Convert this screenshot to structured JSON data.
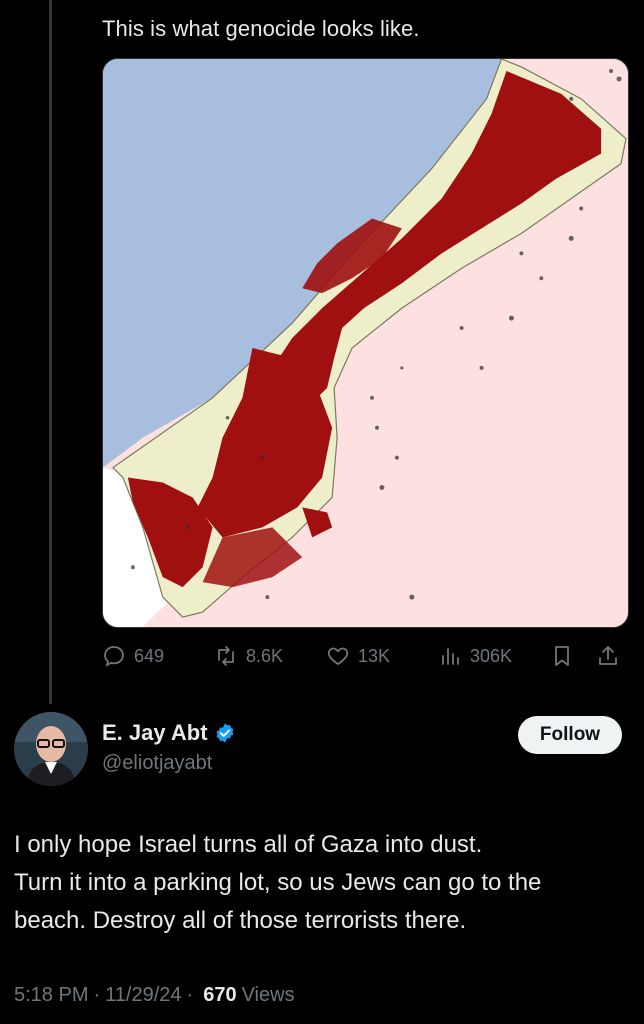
{
  "quoted_tweet": {
    "text": "This is what genocide looks like.",
    "stats": {
      "replies": "649",
      "reposts": "8.6K",
      "likes": "13K",
      "views": "306K"
    }
  },
  "tweet": {
    "author": {
      "name": "E. Jay Abt",
      "handle": "@eliotjayabt",
      "verified": true
    },
    "follow_label": "Follow",
    "body_lines": [
      "I only hope Israel turns all of Gaza into dust.",
      "Turn it into a parking lot, so us Jews can go to the",
      "beach.  Destroy all of those terrorists there."
    ],
    "time": "5:18 PM",
    "date": "11/29/24",
    "views_count": "670",
    "views_label": "Views"
  },
  "colors": {
    "background": "#000000",
    "text_primary": "#e7e9ea",
    "text_secondary": "#71767b",
    "verified_blue": "#1d9bf0",
    "map_sea": "#a7bedf",
    "map_land_outside": "#fde0e0",
    "map_strip": "#efeecb",
    "map_damage": "#a01010"
  },
  "icons": [
    "reply-icon",
    "repost-icon",
    "like-icon",
    "views-icon",
    "bookmark-icon",
    "share-icon",
    "verified-badge-icon"
  ]
}
